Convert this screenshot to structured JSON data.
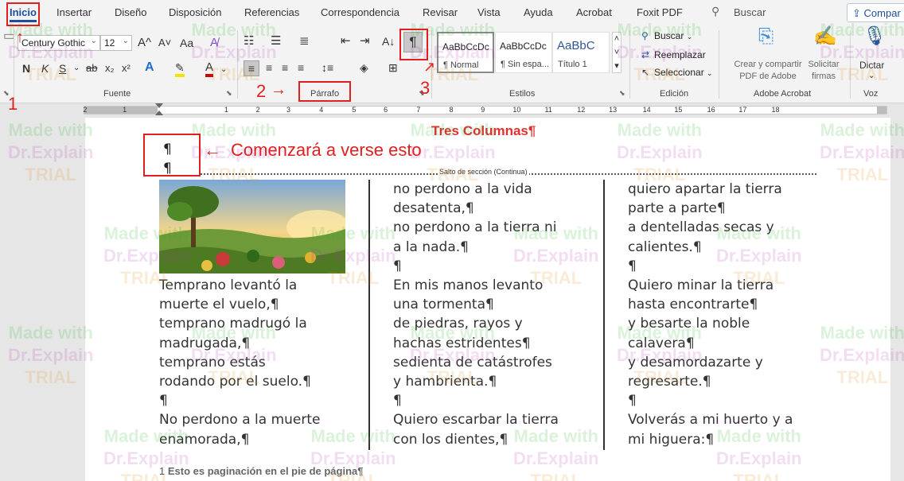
{
  "tabs": [
    "Inicio",
    "Insertar",
    "Diseño",
    "Disposición",
    "Referencias",
    "Correspondencia",
    "Revisar",
    "Vista",
    "Ayuda",
    "Acrobat",
    "Foxit PDF"
  ],
  "active_tab": "Inicio",
  "search": {
    "label": "Buscar"
  },
  "share_label": "Compar",
  "ribbon": {
    "font": {
      "name": "Century Gothic",
      "size": "12",
      "group_label": "Fuente",
      "grow": "A^",
      "shrink": "A˅",
      "case": "Aa",
      "bold": "N",
      "italic": "K",
      "underline": "S",
      "strike": "ab",
      "sub": "x₂",
      "super": "x²",
      "effects": "A",
      "highlight": "✎",
      "color": "A"
    },
    "paragraph": {
      "group_label": "Párrafo",
      "show_marks": "¶"
    },
    "styles": {
      "group_label": "Estilos",
      "items": [
        {
          "preview": "AaBbCcDc",
          "name": "¶ Normal"
        },
        {
          "preview": "AaBbCcDc",
          "name": "¶ Sin espa..."
        },
        {
          "preview": "AaBbC",
          "name": "Título 1"
        }
      ]
    },
    "editing": {
      "group_label": "Edición",
      "find": "Buscar",
      "replace": "Reemplazar",
      "select": "Seleccionar"
    },
    "acrobat": {
      "group_label": "Adobe Acrobat",
      "create_share": "Crear y compartir PDF de Adobe",
      "request_sign": "Solicitar firmas"
    },
    "voice": {
      "group_label": "Voz",
      "dictate": "Dictar"
    }
  },
  "ruler": {
    "numbers": [
      "2",
      "1",
      "1",
      "2",
      "3",
      "4",
      "5",
      "6",
      "7",
      "8",
      "9",
      "10",
      "11",
      "12",
      "13",
      "14",
      "15",
      "16",
      "17",
      "18"
    ]
  },
  "document": {
    "title": "Tres Columnas¶",
    "para_marks": [
      "¶",
      "¶"
    ],
    "section_break": "Salto de sección (Continua)",
    "columns": [
      [
        "Temprano levantó la ",
        "muerte el vuelo,¶",
        "temprano madrugó la ",
        "madrugada,¶",
        "temprano estás ",
        "rodando por el suelo.¶",
        "¶",
        "No perdono a la muerte ",
        "enamorada,¶"
      ],
      [
        "no perdono a la vida ",
        "desatenta,¶",
        "no perdono a la tierra ni ",
        "a la nada.¶",
        "¶",
        "En mis manos levanto ",
        "una tormenta¶",
        "de piedras, rayos y ",
        "hachas estridentes¶",
        "sedienta de catástrofes ",
        "y hambrienta.¶",
        "¶",
        "Quiero escarbar la tierra ",
        "con los dientes,¶"
      ],
      [
        "quiero apartar la tierra ",
        "parte a parte¶",
        "a dentelladas secas y ",
        "calientes.¶",
        "¶",
        "Quiero minar la tierra ",
        "hasta encontrarte¶",
        "y besarte la noble ",
        "calavera¶",
        "y desamordazarte y ",
        "regresarte.¶",
        "¶",
        "Volverás a mi huerto y a ",
        "mi higuera:¶"
      ]
    ],
    "footer": {
      "num": "1",
      "text": "Esto es paginación en el pie de página¶"
    }
  },
  "annotations": {
    "label_1": "1",
    "label_2": "2",
    "label_3": "3",
    "callout": "Comenzará a verse esto"
  },
  "watermark": {
    "line1": "Made with",
    "line2": "Dr.Explain",
    "line3": "TRIAL"
  }
}
